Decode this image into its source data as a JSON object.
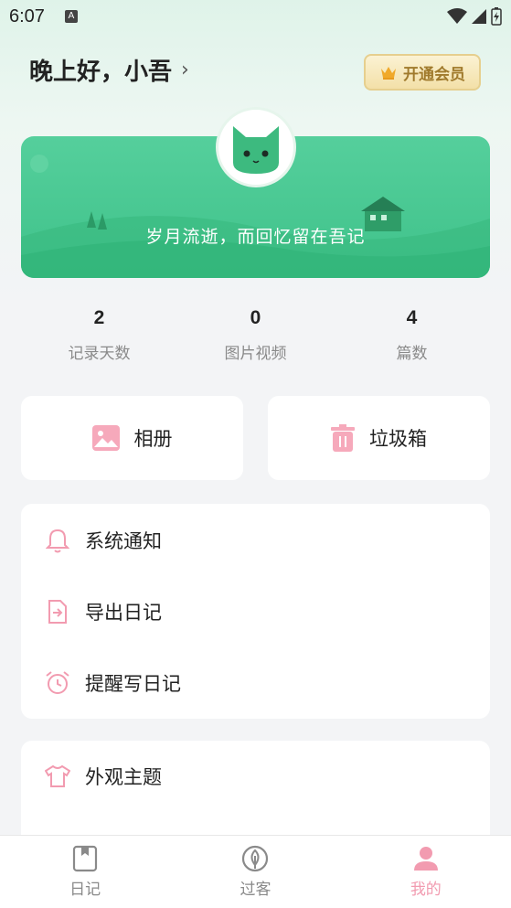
{
  "status_bar": {
    "time": "6:07"
  },
  "header": {
    "greeting": "晚上好，小吾",
    "vip_label": "开通会员"
  },
  "banner": {
    "slogan": "岁月流逝，而回忆留在吾记"
  },
  "stats": [
    {
      "value": "2",
      "label": "记录天数"
    },
    {
      "value": "0",
      "label": "图片视频"
    },
    {
      "value": "4",
      "label": "篇数"
    }
  ],
  "quick_actions": {
    "album": "相册",
    "trash": "垃圾箱"
  },
  "menu1": [
    {
      "label": "系统通知",
      "icon": "bell-icon"
    },
    {
      "label": "导出日记",
      "icon": "export-icon"
    },
    {
      "label": "提醒写日记",
      "icon": "alarm-clock-icon"
    }
  ],
  "menu2": [
    {
      "label": "外观主题",
      "icon": "tshirt-icon"
    }
  ],
  "tabbar": [
    {
      "label": "日记",
      "icon": "diary-book-icon"
    },
    {
      "label": "过客",
      "icon": "leaf-icon"
    },
    {
      "label": "我的",
      "icon": "profile-icon"
    }
  ],
  "colors": {
    "accent_pink": "#f29bb0",
    "banner_green": "#4ac893",
    "vip_gold": "#a07a2c"
  }
}
